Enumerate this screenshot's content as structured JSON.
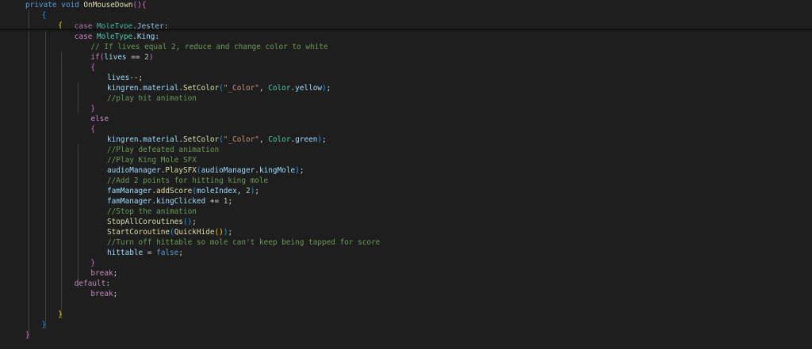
{
  "editor": {
    "colors": {
      "background": "#1e1e1e",
      "default_text": "#d4d4d4",
      "keyword": "#569cd6",
      "control": "#c586c0",
      "function": "#dcdcaa",
      "type": "#4ec9b0",
      "variable": "#9cdcfe",
      "string": "#ce9178",
      "number": "#b5cea8",
      "comment": "#6a9955",
      "bracket_yellow": "#ffd700",
      "bracket_purple": "#da70d6",
      "bracket_blue": "#179fff",
      "indent_guide": "#404040"
    },
    "lines": [
      {
        "indent": 0,
        "tokens": [
          {
            "t": "private",
            "c": "keyword"
          },
          {
            "t": " ",
            "c": "default"
          },
          {
            "t": "void",
            "c": "keyword"
          },
          {
            "t": " ",
            "c": "default"
          },
          {
            "t": "OnMouseDown",
            "c": "function"
          },
          {
            "t": "(",
            "c": "bracket_purple"
          },
          {
            "t": ")",
            "c": "bracket_purple"
          },
          {
            "t": "{",
            "c": "bracket_purple"
          }
        ]
      },
      {
        "indent": 1,
        "tokens": [
          {
            "t": "{",
            "c": "bracket_blue"
          }
        ]
      },
      {
        "indent": 2,
        "tokens": [
          {
            "t": "{",
            "c": "bracket_yellow"
          }
        ]
      },
      {
        "indent": 3,
        "partial": true,
        "tokens": [
          {
            "t": "case",
            "c": "control"
          },
          {
            "t": " ",
            "c": "default"
          },
          {
            "t": "MoleType",
            "c": "type"
          },
          {
            "t": ".",
            "c": "default"
          },
          {
            "t": "Jester",
            "c": "variable"
          },
          {
            "t": ":",
            "c": "default"
          }
        ]
      },
      {
        "indent": 3,
        "tokens": [
          {
            "t": "case",
            "c": "control"
          },
          {
            "t": " ",
            "c": "default"
          },
          {
            "t": "MoleType",
            "c": "type"
          },
          {
            "t": ".",
            "c": "default"
          },
          {
            "t": "King",
            "c": "variable"
          },
          {
            "t": ":",
            "c": "default"
          }
        ]
      },
      {
        "indent": 4,
        "tokens": [
          {
            "t": "// If lives equal 2, reduce and change color to white",
            "c": "comment"
          }
        ]
      },
      {
        "indent": 4,
        "tokens": [
          {
            "t": "if",
            "c": "control"
          },
          {
            "t": "(",
            "c": "bracket_purple"
          },
          {
            "t": "lives",
            "c": "variable"
          },
          {
            "t": " == ",
            "c": "default"
          },
          {
            "t": "2",
            "c": "number"
          },
          {
            "t": ")",
            "c": "bracket_purple"
          }
        ]
      },
      {
        "indent": 4,
        "tokens": [
          {
            "t": "{",
            "c": "bracket_purple"
          }
        ]
      },
      {
        "indent": 5,
        "tokens": [
          {
            "t": "lives",
            "c": "variable"
          },
          {
            "t": "--;",
            "c": "default"
          }
        ]
      },
      {
        "indent": 5,
        "tokens": [
          {
            "t": "kingren",
            "c": "variable"
          },
          {
            "t": ".",
            "c": "default"
          },
          {
            "t": "material",
            "c": "variable"
          },
          {
            "t": ".",
            "c": "default"
          },
          {
            "t": "SetColor",
            "c": "function"
          },
          {
            "t": "(",
            "c": "bracket_blue"
          },
          {
            "t": "\"_Color\"",
            "c": "string"
          },
          {
            "t": ", ",
            "c": "default"
          },
          {
            "t": "Color",
            "c": "type"
          },
          {
            "t": ".",
            "c": "default"
          },
          {
            "t": "yellow",
            "c": "variable"
          },
          {
            "t": ")",
            "c": "bracket_blue"
          },
          {
            "t": ";",
            "c": "default"
          }
        ]
      },
      {
        "indent": 5,
        "tokens": [
          {
            "t": "//play hit animation",
            "c": "comment"
          }
        ]
      },
      {
        "indent": 4,
        "tokens": [
          {
            "t": "}",
            "c": "bracket_purple"
          }
        ]
      },
      {
        "indent": 4,
        "tokens": [
          {
            "t": "else",
            "c": "control"
          }
        ]
      },
      {
        "indent": 4,
        "tokens": [
          {
            "t": "{",
            "c": "bracket_purple"
          }
        ]
      },
      {
        "indent": 5,
        "tokens": [
          {
            "t": "kingren",
            "c": "variable"
          },
          {
            "t": ".",
            "c": "default"
          },
          {
            "t": "material",
            "c": "variable"
          },
          {
            "t": ".",
            "c": "default"
          },
          {
            "t": "SetColor",
            "c": "function"
          },
          {
            "t": "(",
            "c": "bracket_blue"
          },
          {
            "t": "\"_Color\"",
            "c": "string"
          },
          {
            "t": ", ",
            "c": "default"
          },
          {
            "t": "Color",
            "c": "type"
          },
          {
            "t": ".",
            "c": "default"
          },
          {
            "t": "green",
            "c": "variable"
          },
          {
            "t": ")",
            "c": "bracket_blue"
          },
          {
            "t": ";",
            "c": "default"
          }
        ]
      },
      {
        "indent": 5,
        "tokens": [
          {
            "t": "//Play defeated animation",
            "c": "comment"
          }
        ]
      },
      {
        "indent": 5,
        "tokens": [
          {
            "t": "//Play King Mole SFX",
            "c": "comment"
          }
        ]
      },
      {
        "indent": 5,
        "tokens": [
          {
            "t": "audioManager",
            "c": "variable"
          },
          {
            "t": ".",
            "c": "default"
          },
          {
            "t": "PlaySFX",
            "c": "function"
          },
          {
            "t": "(",
            "c": "bracket_blue"
          },
          {
            "t": "audioManager",
            "c": "variable"
          },
          {
            "t": ".",
            "c": "default"
          },
          {
            "t": "kingMole",
            "c": "variable"
          },
          {
            "t": ")",
            "c": "bracket_blue"
          },
          {
            "t": ";",
            "c": "default"
          }
        ]
      },
      {
        "indent": 5,
        "tokens": [
          {
            "t": "//Add 2 points for hitting king mole",
            "c": "comment"
          }
        ]
      },
      {
        "indent": 5,
        "tokens": [
          {
            "t": "famManager",
            "c": "variable"
          },
          {
            "t": ".",
            "c": "default"
          },
          {
            "t": "addScore",
            "c": "function"
          },
          {
            "t": "(",
            "c": "bracket_blue"
          },
          {
            "t": "moleIndex",
            "c": "variable"
          },
          {
            "t": ", ",
            "c": "default"
          },
          {
            "t": "2",
            "c": "number"
          },
          {
            "t": ")",
            "c": "bracket_blue"
          },
          {
            "t": ";",
            "c": "default"
          }
        ]
      },
      {
        "indent": 5,
        "tokens": [
          {
            "t": "famManager",
            "c": "variable"
          },
          {
            "t": ".",
            "c": "default"
          },
          {
            "t": "kingClicked",
            "c": "variable"
          },
          {
            "t": " += ",
            "c": "default"
          },
          {
            "t": "1",
            "c": "number"
          },
          {
            "t": ";",
            "c": "default"
          }
        ]
      },
      {
        "indent": 5,
        "tokens": [
          {
            "t": "//Stop the animation",
            "c": "comment"
          }
        ]
      },
      {
        "indent": 5,
        "tokens": [
          {
            "t": "StopAllCoroutines",
            "c": "function"
          },
          {
            "t": "(",
            "c": "bracket_blue"
          },
          {
            "t": ")",
            "c": "bracket_blue"
          },
          {
            "t": ";",
            "c": "default"
          }
        ]
      },
      {
        "indent": 5,
        "tokens": [
          {
            "t": "StartCoroutine",
            "c": "function"
          },
          {
            "t": "(",
            "c": "bracket_blue"
          },
          {
            "t": "QuickHide",
            "c": "function"
          },
          {
            "t": "(",
            "c": "bracket_yellow"
          },
          {
            "t": ")",
            "c": "bracket_yellow"
          },
          {
            "t": ")",
            "c": "bracket_blue"
          },
          {
            "t": ";",
            "c": "default"
          }
        ]
      },
      {
        "indent": 5,
        "tokens": [
          {
            "t": "//Turn off hittable so mole can't keep being tapped for score",
            "c": "comment"
          }
        ]
      },
      {
        "indent": 5,
        "tokens": [
          {
            "t": "hittable",
            "c": "variable"
          },
          {
            "t": " = ",
            "c": "default"
          },
          {
            "t": "false",
            "c": "keyword"
          },
          {
            "t": ";",
            "c": "default"
          }
        ]
      },
      {
        "indent": 4,
        "tokens": [
          {
            "t": "}",
            "c": "bracket_purple"
          }
        ]
      },
      {
        "indent": 4,
        "tokens": [
          {
            "t": "break",
            "c": "control"
          },
          {
            "t": ";",
            "c": "default"
          }
        ]
      },
      {
        "indent": 3,
        "tokens": [
          {
            "t": "default",
            "c": "control"
          },
          {
            "t": ":",
            "c": "default"
          }
        ]
      },
      {
        "indent": 4,
        "tokens": [
          {
            "t": "break",
            "c": "control"
          },
          {
            "t": ";",
            "c": "default"
          }
        ]
      },
      {
        "indent": 0,
        "tokens": []
      },
      {
        "indent": 2,
        "tokens": [
          {
            "t": "}",
            "c": "bracket_yellow"
          }
        ]
      },
      {
        "indent": 1,
        "tokens": [
          {
            "t": "}",
            "c": "bracket_blue"
          }
        ]
      },
      {
        "indent": 0,
        "tokens": [
          {
            "t": "}",
            "c": "bracket_purple"
          }
        ]
      }
    ]
  }
}
